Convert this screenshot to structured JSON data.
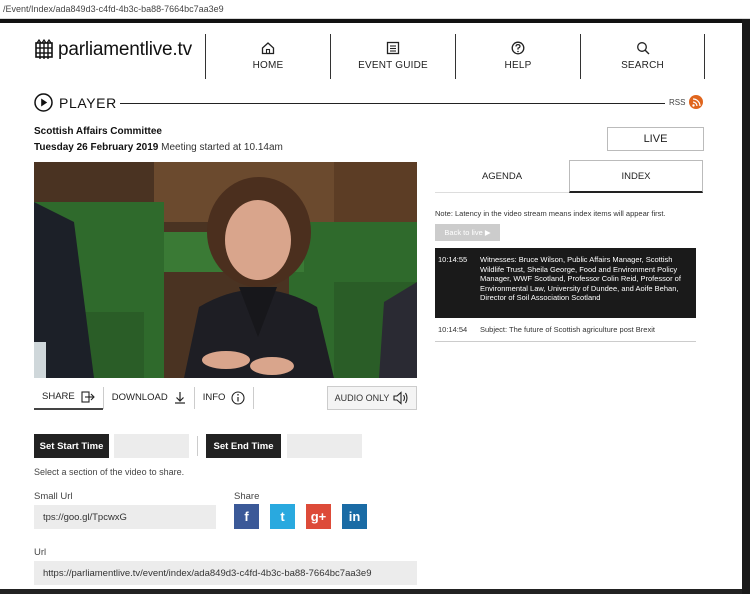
{
  "browser": {
    "url": "/Event/Index/ada849d3-c4fd-4b3c-ba88-7664bc7aa3e9"
  },
  "site": {
    "logo_text": "parliamentlive.tv"
  },
  "nav": [
    {
      "label": "HOME",
      "icon": "home-icon"
    },
    {
      "label": "EVENT GUIDE",
      "icon": "guide-icon"
    },
    {
      "label": "HELP",
      "icon": "help-icon"
    },
    {
      "label": "SEARCH",
      "icon": "search-icon"
    }
  ],
  "player": {
    "heading": "PLAYER",
    "rss_label": "RSS",
    "committee": "Scottish Affairs Committee",
    "date": "Tuesday 26 February 2019",
    "meeting_started": "Meeting started at 10.14am",
    "live_label": "LIVE"
  },
  "controls": {
    "share_label": "SHARE",
    "download_label": "DOWNLOAD",
    "info_label": "INFO",
    "audio_only_label": "AUDIO ONLY",
    "set_start_label": "Set Start Time",
    "set_end_label": "Set End Time",
    "select_hint": "Select a section of the video to share.",
    "small_url_label": "Small Url",
    "small_url_value": "tps://goo.gl/TpcwxG",
    "share_heading": "Share",
    "url_label": "Url",
    "url_value": "https://parliamentlive.tv/event/index/ada849d3-c4fd-4b3c-ba88-7664bc7aa3e9"
  },
  "social": {
    "facebook": "f",
    "twitter": "t",
    "google": "g+",
    "linkedin": "in"
  },
  "right_panel": {
    "tabs": [
      "AGENDA",
      "INDEX"
    ],
    "latency_note": "Note: Latency in the video stream means index items will appear first.",
    "back_to_live": "Back to live ▶",
    "index_items": [
      {
        "time": "10:14:55",
        "text": "Witnesses: Bruce Wilson, Public Affairs Manager, Scottish Wildlife Trust, Sheila George, Food and Environment Policy Manager, WWF Scotland, Professor Colin Reid, Professor of Environmental Law, University of Dundee, and Aoife Behan, Director of Soil Association Scotland"
      },
      {
        "time": "10:14:54",
        "text": "Subject: The future of Scottish agriculture post Brexit"
      }
    ]
  },
  "colors": {
    "rss": "#e0651d",
    "facebook": "#3b5998",
    "twitter": "#29a9df",
    "google": "#dd4b39",
    "linkedin": "#1a6ba5",
    "active_index_bg": "#1a1a1a"
  }
}
